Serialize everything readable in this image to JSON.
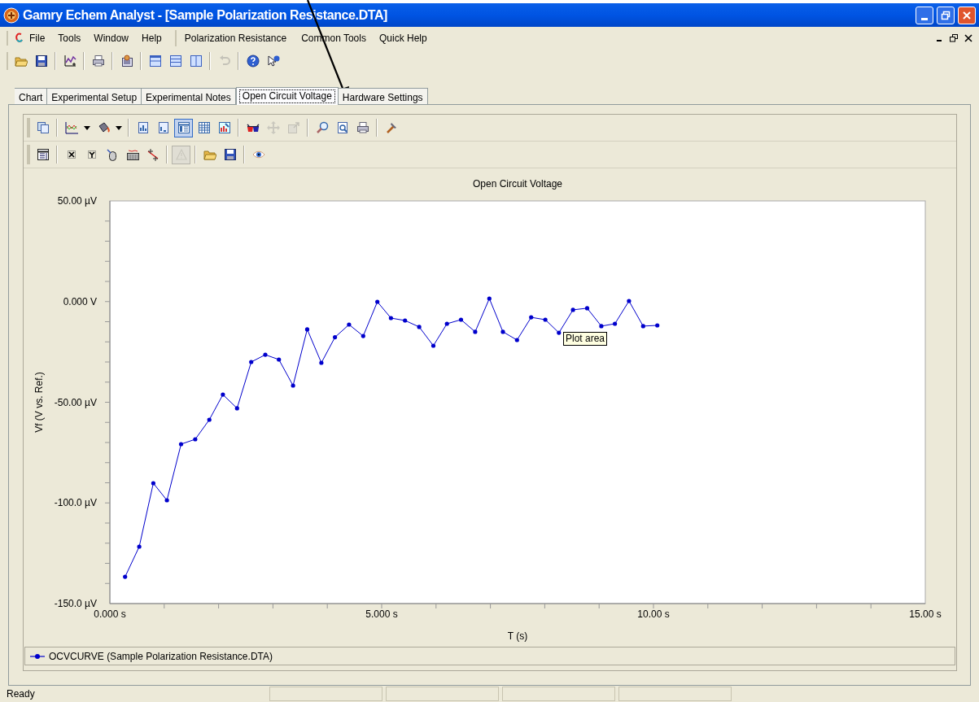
{
  "window": {
    "title": "Gamry Echem Analyst - [Sample Polarization Resistance.DTA]"
  },
  "menu": [
    "File",
    "Tools",
    "Window",
    "Help",
    "Polarization Resistance",
    "Common Tools",
    "Quick Help"
  ],
  "toolbar": [
    {
      "kind": "open",
      "disabled": false
    },
    {
      "kind": "save",
      "disabled": false
    },
    {
      "kind": "sep"
    },
    {
      "kind": "newchart",
      "disabled": false
    },
    {
      "kind": "sep"
    },
    {
      "kind": "print",
      "disabled": false
    },
    {
      "kind": "sep"
    },
    {
      "kind": "report",
      "disabled": false
    },
    {
      "kind": "sep"
    },
    {
      "kind": "hsplit",
      "disabled": false
    },
    {
      "kind": "stack",
      "disabled": false
    },
    {
      "kind": "vsplit",
      "disabled": false
    },
    {
      "kind": "sep"
    },
    {
      "kind": "undo",
      "disabled": true
    },
    {
      "kind": "sep"
    },
    {
      "kind": "help",
      "disabled": false
    },
    {
      "kind": "whatsthis",
      "disabled": false
    }
  ],
  "tabs": [
    {
      "label": "Chart",
      "selected": false
    },
    {
      "label": "Experimental Setup",
      "selected": false
    },
    {
      "label": "Experimental Notes",
      "selected": false
    },
    {
      "label": "Open Circuit Voltage",
      "selected": true
    },
    {
      "label": "Hardware Settings",
      "selected": false
    }
  ],
  "chart_toolbar_1": [
    {
      "kind": "copy",
      "disabled": false,
      "selected": false
    },
    {
      "kind": "sep"
    },
    {
      "kind": "linechart",
      "disabled": false,
      "selected": false
    },
    {
      "kind": "caret",
      "disabled": false,
      "selected": false
    },
    {
      "kind": "bucket",
      "disabled": false,
      "selected": false
    },
    {
      "kind": "caret",
      "disabled": false,
      "selected": false
    },
    {
      "kind": "sep"
    },
    {
      "kind": "docchart",
      "disabled": false,
      "selected": false
    },
    {
      "kind": "doc",
      "disabled": false,
      "selected": false
    },
    {
      "kind": "list",
      "disabled": false,
      "selected": true
    },
    {
      "kind": "grid",
      "disabled": false,
      "selected": false
    },
    {
      "kind": "picture",
      "disabled": false,
      "selected": false
    },
    {
      "kind": "sep"
    },
    {
      "kind": "glasses",
      "disabled": false,
      "selected": false
    },
    {
      "kind": "move",
      "disabled": true,
      "selected": false
    },
    {
      "kind": "export",
      "disabled": true,
      "selected": false
    },
    {
      "kind": "sep"
    },
    {
      "kind": "zoom",
      "disabled": false,
      "selected": false
    },
    {
      "kind": "preview",
      "disabled": false,
      "selected": false
    },
    {
      "kind": "print",
      "disabled": false,
      "selected": false
    },
    {
      "kind": "sep"
    },
    {
      "kind": "hammer",
      "disabled": false,
      "selected": false
    }
  ],
  "chart_toolbar_2": [
    {
      "kind": "table",
      "disabled": false,
      "selected": false
    },
    {
      "kind": "sep"
    },
    {
      "kind": "xcursor",
      "disabled": false,
      "selected": false
    },
    {
      "kind": "ycursor",
      "disabled": false,
      "selected": false
    },
    {
      "kind": "mouse",
      "disabled": false,
      "selected": false
    },
    {
      "kind": "keyboard",
      "disabled": false,
      "selected": false
    },
    {
      "kind": "fitline",
      "disabled": false,
      "selected": false
    },
    {
      "kind": "sep"
    },
    {
      "kind": "warning",
      "disabled": true,
      "selected": true
    },
    {
      "kind": "sep"
    },
    {
      "kind": "open",
      "disabled": false,
      "selected": false
    },
    {
      "kind": "save",
      "disabled": false,
      "selected": false
    },
    {
      "kind": "sep"
    },
    {
      "kind": "eye",
      "disabled": false,
      "selected": false
    }
  ],
  "chart": {
    "tooltip": "Plot area",
    "chart_data": {
      "type": "line",
      "title": "Open Circuit Voltage",
      "xlabel": "T (s)",
      "ylabel": "Vf (V vs. Ref.)",
      "x": [
        0.28,
        0.54,
        0.8,
        1.05,
        1.31,
        1.57,
        1.83,
        2.08,
        2.34,
        2.6,
        2.86,
        3.11,
        3.37,
        3.63,
        3.89,
        4.14,
        4.4,
        4.66,
        4.92,
        5.17,
        5.43,
        5.69,
        5.95,
        6.2,
        6.46,
        6.72,
        6.98,
        7.23,
        7.49,
        7.75,
        8.01,
        8.26,
        8.52,
        8.78,
        9.04,
        9.29,
        9.55,
        9.81,
        10.07
      ],
      "series": [
        {
          "name": "OCVCURVE (Sample Polarization Resistance.DTA)",
          "color": "#0000cc",
          "values": [
            -136.7,
            -121.7,
            -90.2,
            -98.7,
            -70.8,
            -68.4,
            -58.7,
            -46.2,
            -53.0,
            -30.0,
            -26.4,
            -28.8,
            -41.7,
            -13.8,
            -30.4,
            -17.7,
            -11.4,
            -17.1,
            -0.1,
            -8.2,
            -9.4,
            -12.6,
            -21.9,
            -11.0,
            -9.0,
            -15.0,
            1.5,
            -15.0,
            -19.1,
            -7.8,
            -9.0,
            -15.5,
            -4.1,
            -3.3,
            -12.2,
            -11.0,
            0.3,
            -12.2,
            -11.8
          ]
        }
      ],
      "xlim": [
        0,
        15
      ],
      "ylim": [
        -150,
        50
      ],
      "xticks": [
        {
          "value": 0,
          "label": "0.000 s"
        },
        {
          "value": 5,
          "label": "5.000 s"
        },
        {
          "value": 10,
          "label": "10.00 s"
        },
        {
          "value": 15,
          "label": "15.00 s"
        }
      ],
      "yticks": [
        {
          "value": 50,
          "label": "50.00 µV"
        },
        {
          "value": 0,
          "label": "0.000 V"
        },
        {
          "value": -50,
          "label": "-50.00 µV"
        },
        {
          "value": -100,
          "label": "-100.0 µV"
        },
        {
          "value": -150,
          "label": "-150.0 µV"
        }
      ]
    }
  },
  "status_bar": {
    "text": "Ready"
  }
}
